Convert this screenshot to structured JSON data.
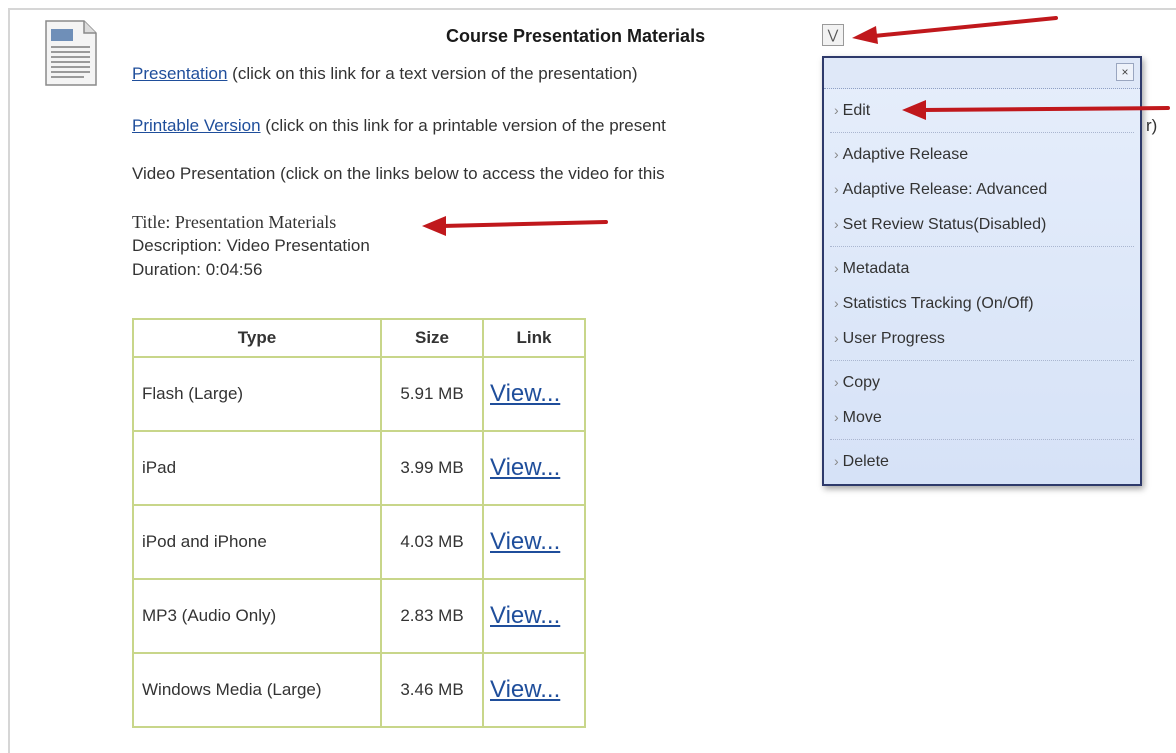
{
  "item": {
    "title": "Course Presentation Materials",
    "toggle_icon": "double-chevron-down-icon"
  },
  "links": {
    "presentation_link": "Presentation",
    "presentation_note": " (click on this link for a text version of the presentation)",
    "printable_link": "Printable Version",
    "printable_note": " (click on this link for a printable version of the present",
    "printable_tail": "r)",
    "video_note": "Video Presentation (click on the links below to access the video for this"
  },
  "meta": {
    "title": "Title: Presentation Materials",
    "description": "Description: Video Presentation",
    "duration": "Duration: 0:04:56"
  },
  "table": {
    "headers": [
      "Type",
      "Size",
      "Link"
    ],
    "rows": [
      {
        "type": "Flash (Large)",
        "size": "5.91 MB",
        "link": "View..."
      },
      {
        "type": "iPad",
        "size": "3.99 MB",
        "link": "View..."
      },
      {
        "type": "iPod and iPhone",
        "size": "4.03 MB",
        "link": "View..."
      },
      {
        "type": "MP3 (Audio Only)",
        "size": "2.83 MB",
        "link": "View..."
      },
      {
        "type": "Windows Media (Large)",
        "size": "3.46 MB",
        "link": "View..."
      }
    ]
  },
  "context_menu": {
    "close_label": "×",
    "groups": [
      [
        "Edit"
      ],
      [
        "Adaptive Release",
        "Adaptive Release: Advanced",
        "Set Review Status(Disabled)"
      ],
      [
        "Metadata",
        "Statistics Tracking (On/Off)",
        "User Progress"
      ],
      [
        "Copy",
        "Move"
      ],
      [
        "Delete"
      ]
    ]
  },
  "colors": {
    "arrow": "#c0181c",
    "link": "#1f4e9b",
    "table_border": "#c8d68a",
    "menu_border": "#2e3a6b"
  }
}
